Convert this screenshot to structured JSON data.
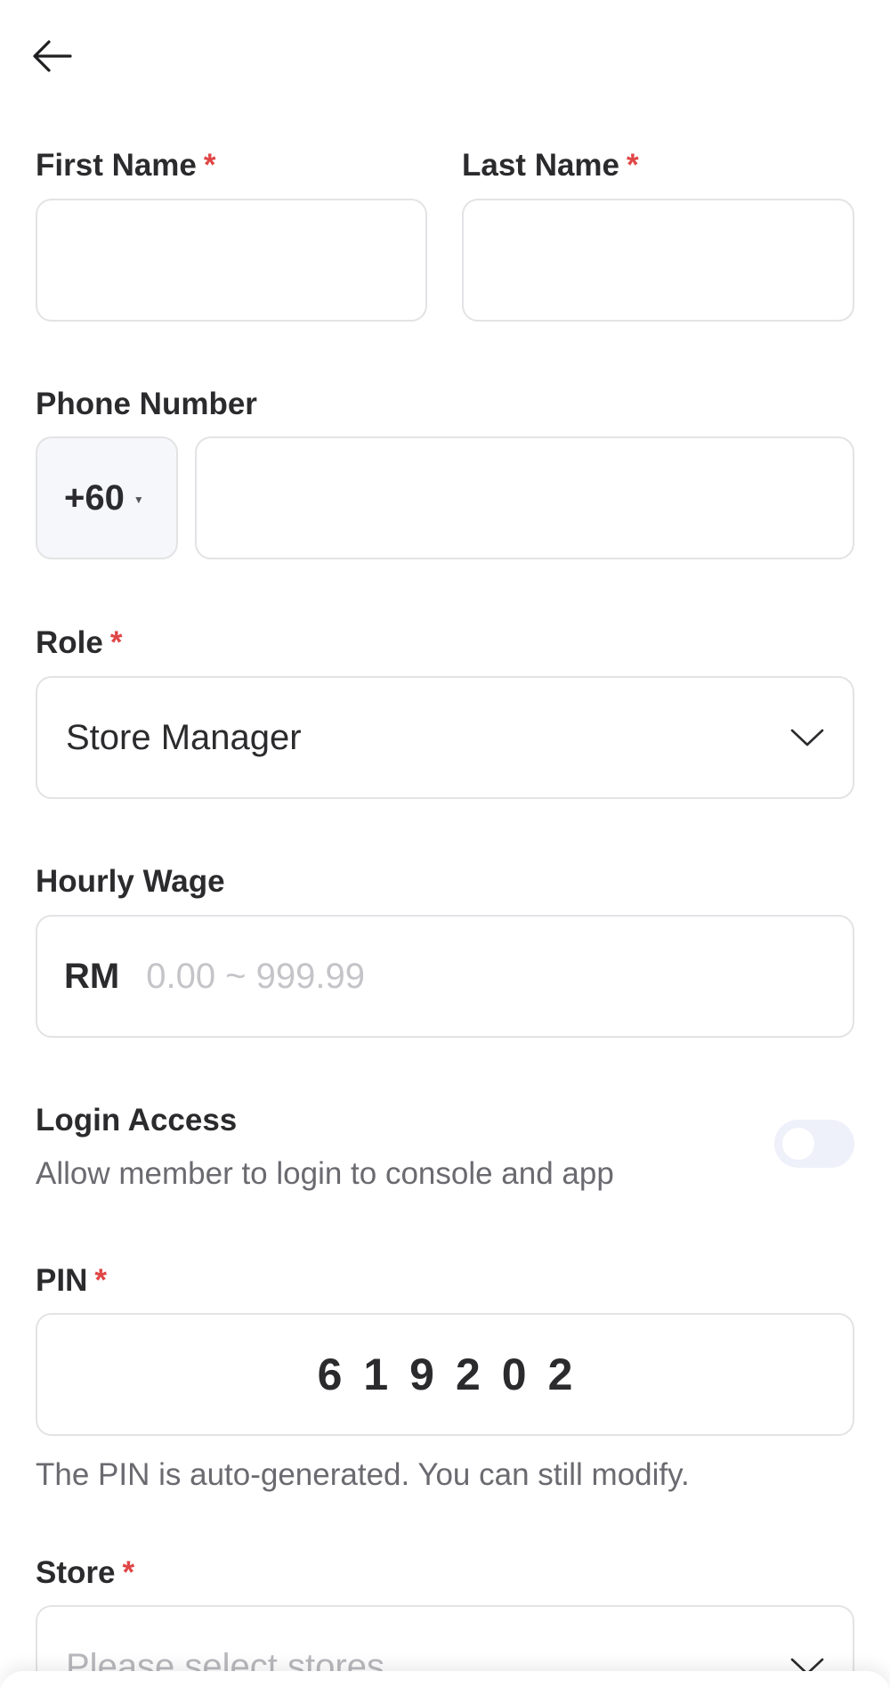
{
  "form": {
    "first_name": {
      "label": "First Name",
      "required_mark": "*",
      "value": ""
    },
    "last_name": {
      "label": "Last Name",
      "required_mark": "*",
      "value": ""
    },
    "phone": {
      "label": "Phone Number",
      "country_code": "+60",
      "value": ""
    },
    "role": {
      "label": "Role",
      "required_mark": "*",
      "value": "Store Manager"
    },
    "hourly_wage": {
      "label": "Hourly Wage",
      "currency": "RM",
      "placeholder": "0.00 ~ 999.99",
      "value": ""
    },
    "login_access": {
      "label": "Login Access",
      "description": "Allow member to login to console and app",
      "enabled": false
    },
    "pin": {
      "label": "PIN",
      "required_mark": "*",
      "value": "619202",
      "display": "6 1 9 2 0 2",
      "hint": "The PIN is auto-generated. You can still modify."
    },
    "store": {
      "label": "Store",
      "required_mark": "*",
      "placeholder": "Please select stores"
    }
  },
  "icons": {
    "back": "arrow-left-icon",
    "dropdown": "chevron-down-icon",
    "country_caret": "caret-down-icon"
  },
  "colors": {
    "required": "#e04545",
    "border": "#e3e3e6",
    "toggle_off": "#eef0fa",
    "placeholder": "#c4c4c9"
  }
}
